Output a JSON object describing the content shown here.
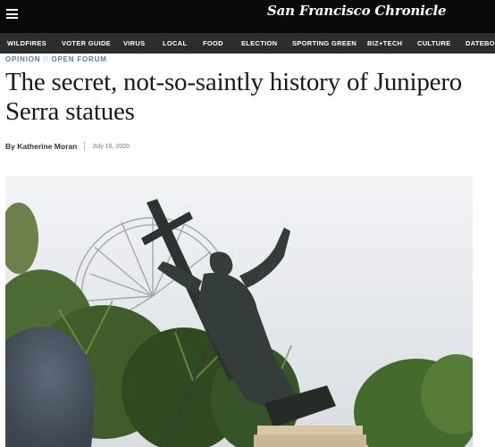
{
  "header": {
    "menu_icon": "hamburger-menu-icon",
    "logo_text": "San Francisco Chronicle"
  },
  "nav": {
    "items": [
      {
        "label": "WILDFIRES"
      },
      {
        "label": "VOTER GUIDE"
      },
      {
        "label": "VIRUS"
      },
      {
        "label": "LOCAL"
      },
      {
        "label": "FOOD"
      },
      {
        "label": "ELECTION"
      },
      {
        "label": "SPORTING GREEN"
      },
      {
        "label": "BIZ+TECH"
      },
      {
        "label": "CULTURE"
      },
      {
        "label": "DATEBOOK"
      }
    ]
  },
  "breadcrumb": {
    "section": "OPINION",
    "separator": "//",
    "subsection": "OPEN FORUM"
  },
  "article": {
    "headline": "The secret, not-so-saintly history of Junipero Serra statues",
    "author": "By Katherine Moran",
    "date": "July 16, 2020"
  },
  "photo": {
    "subject": "toppled-statue-photo"
  },
  "colors": {
    "topbar": "#0a0a0a",
    "navbar": "#2d2d2d",
    "breadcrumb": "#5b7ba2"
  }
}
